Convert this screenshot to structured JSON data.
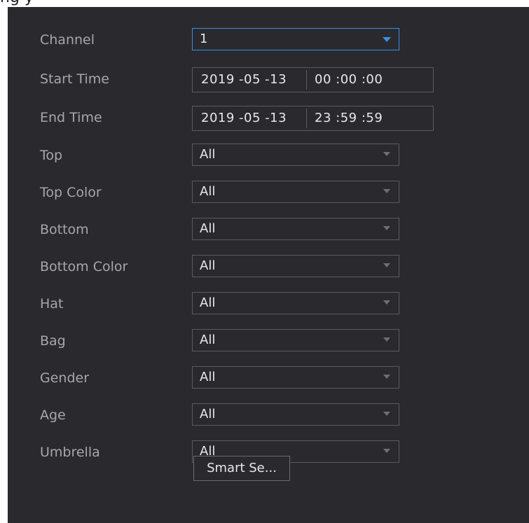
{
  "title_fragment": "ng                           y",
  "form": {
    "channel": {
      "label": "Channel",
      "value": "1"
    },
    "start_time": {
      "label": "Start Time",
      "date": "2019 -05 -13",
      "time": "00 :00 :00"
    },
    "end_time": {
      "label": "End Time",
      "date": "2019 -05 -13",
      "time": "23 :59 :59"
    },
    "top": {
      "label": "Top",
      "value": "All"
    },
    "top_color": {
      "label": "Top Color",
      "value": "All"
    },
    "bottom": {
      "label": "Bottom",
      "value": "All"
    },
    "bottom_color": {
      "label": "Bottom Color",
      "value": "All"
    },
    "hat": {
      "label": "Hat",
      "value": "All"
    },
    "bag": {
      "label": "Bag",
      "value": "All"
    },
    "gender": {
      "label": "Gender",
      "value": "All"
    },
    "age": {
      "label": "Age",
      "value": "All"
    },
    "umbrella": {
      "label": "Umbrella",
      "value": "All"
    }
  },
  "buttons": {
    "smart_search": "Smart Se..."
  },
  "colors": {
    "panel_bg": "#2a2a2e",
    "accent": "#3a8ee6",
    "label": "#a7a7ab"
  }
}
